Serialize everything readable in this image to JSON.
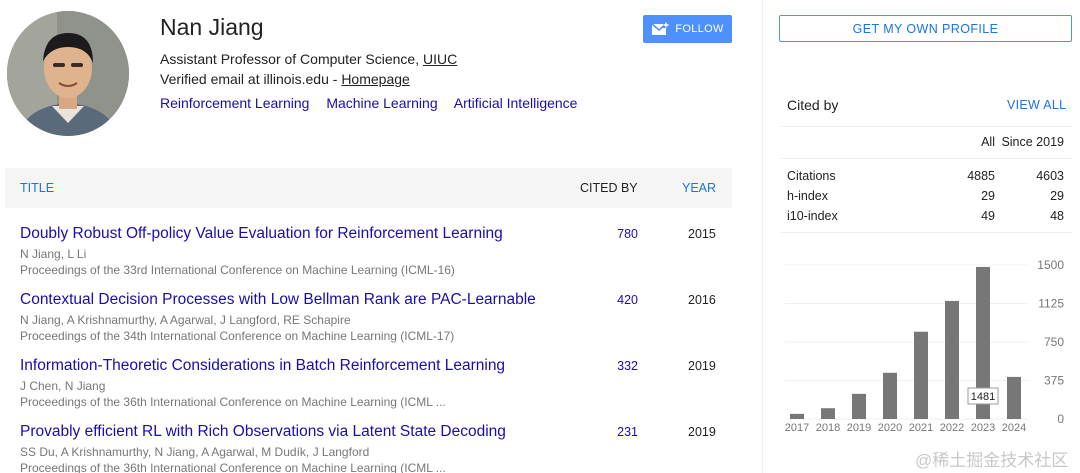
{
  "profile": {
    "name": "Nan Jiang",
    "title_prefix": "Assistant Professor of Computer Science, ",
    "institution": "UIUC",
    "email_prefix": "Verified email at illinois.edu - ",
    "homepage": "Homepage",
    "interests": [
      "Reinforcement Learning",
      "Machine Learning",
      "Artificial Intelligence"
    ],
    "follow_label": "FOLLOW",
    "get_profile_label": "GET MY OWN PROFILE"
  },
  "table": {
    "headers": {
      "title": "TITLE",
      "cited_by": "CITED BY",
      "year": "YEAR"
    },
    "rows": [
      {
        "title": "Doubly Robust Off-policy Value Evaluation for Reinforcement Learning",
        "authors": "N Jiang, L Li",
        "venue": "Proceedings of the 33rd International Conference on Machine Learning (ICML-16)",
        "cited_by": "780",
        "year": "2015"
      },
      {
        "title": "Contextual Decision Processes with Low Bellman Rank are PAC-Learnable",
        "authors": "N Jiang, A Krishnamurthy, A Agarwal, J Langford, RE Schapire",
        "venue": "Proceedings of the 34th International Conference on Machine Learning (ICML-17)",
        "cited_by": "420",
        "year": "2016"
      },
      {
        "title": "Information-Theoretic Considerations in Batch Reinforcement Learning",
        "authors": "J Chen, N Jiang",
        "venue": "Proceedings of the 36th International Conference on Machine Learning (ICML ...",
        "cited_by": "332",
        "year": "2019"
      },
      {
        "title": "Provably efficient RL with Rich Observations via Latent State Decoding",
        "authors": "SS Du, A Krishnamurthy, N Jiang, A Agarwal, M Dudík, J Langford",
        "venue": "Proceedings of the 36th International Conference on Machine Learning (ICML ...",
        "cited_by": "231",
        "year": "2019"
      }
    ]
  },
  "cited_by": {
    "label": "Cited by",
    "view_all": "VIEW ALL",
    "col_all": "All",
    "col_since": "Since 2019",
    "rows": [
      {
        "label": "Citations",
        "all": "4885",
        "since": "4603"
      },
      {
        "label": "h-index",
        "all": "29",
        "since": "29"
      },
      {
        "label": "i10-index",
        "all": "49",
        "since": "48"
      }
    ]
  },
  "chart_data": {
    "type": "bar",
    "categories": [
      "2017",
      "2018",
      "2019",
      "2020",
      "2021",
      "2022",
      "2023",
      "2024"
    ],
    "values": [
      50,
      105,
      245,
      450,
      850,
      1150,
      1481,
      410
    ],
    "ylim": [
      0,
      1500
    ],
    "yticks": [
      "1500",
      "1125",
      "750",
      "375",
      "0"
    ],
    "tooltip": "1481",
    "bar_color": "#777777"
  },
  "watermark": "@稀土掘金技术社区"
}
